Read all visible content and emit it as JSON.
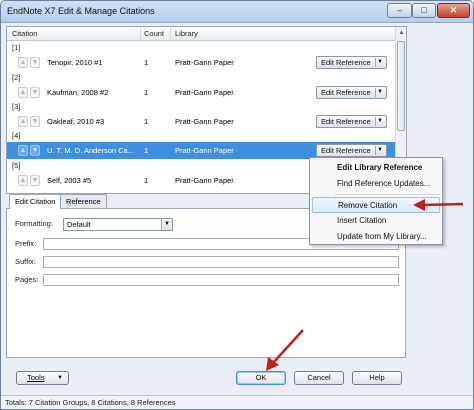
{
  "window": {
    "title": "EndNote X7 Edit & Manage Citations",
    "minimize": "–",
    "maximize": "□",
    "close": "✕"
  },
  "grid": {
    "headers": [
      "Citation",
      "Count",
      "Library"
    ],
    "groups": [
      {
        "label": "[1]",
        "citation": "Tenopir, 2010 #1",
        "count": "1",
        "library": "Pratt-Gann Paper",
        "button": "Edit Reference"
      },
      {
        "label": "[2]",
        "citation": "Kaufman, 2008 #2",
        "count": "1",
        "library": "Pratt-Gann Paper",
        "button": "Edit Reference"
      },
      {
        "label": "[3]",
        "citation": "Oakleaf, 2010 #3",
        "count": "1",
        "library": "Pratt-Gann Paper",
        "button": "Edit Reference"
      },
      {
        "label": "[4]",
        "citation": "U. T. M. D. Anderson Ca...",
        "count": "1",
        "library": "Pratt-Gann Paper",
        "button": "Edit Reference"
      },
      {
        "label": "[5]",
        "citation": "Self, 2003 #5",
        "count": "1",
        "library": "Pratt-Gann Paper",
        "button": ""
      }
    ]
  },
  "context_menu": {
    "items": [
      "Edit Library Reference",
      "Find Reference Updates...",
      "Remove Citation",
      "Insert Citation",
      "Update from My Library..."
    ]
  },
  "tabs": {
    "edit_citation": "Edit Citation",
    "reference": "Reference"
  },
  "form": {
    "formatting_label": "Formatting:",
    "formatting_value": "Default",
    "prefix_label": "Prefix:",
    "suffix_label": "Suffix:",
    "pages_label": "Pages:"
  },
  "buttons": {
    "tools": "Tools",
    "ok": "OK",
    "cancel": "Cancel",
    "help": "Help"
  },
  "status": {
    "text": "Totals: 7 Citation Groups, 8 Citations, 8 References"
  }
}
